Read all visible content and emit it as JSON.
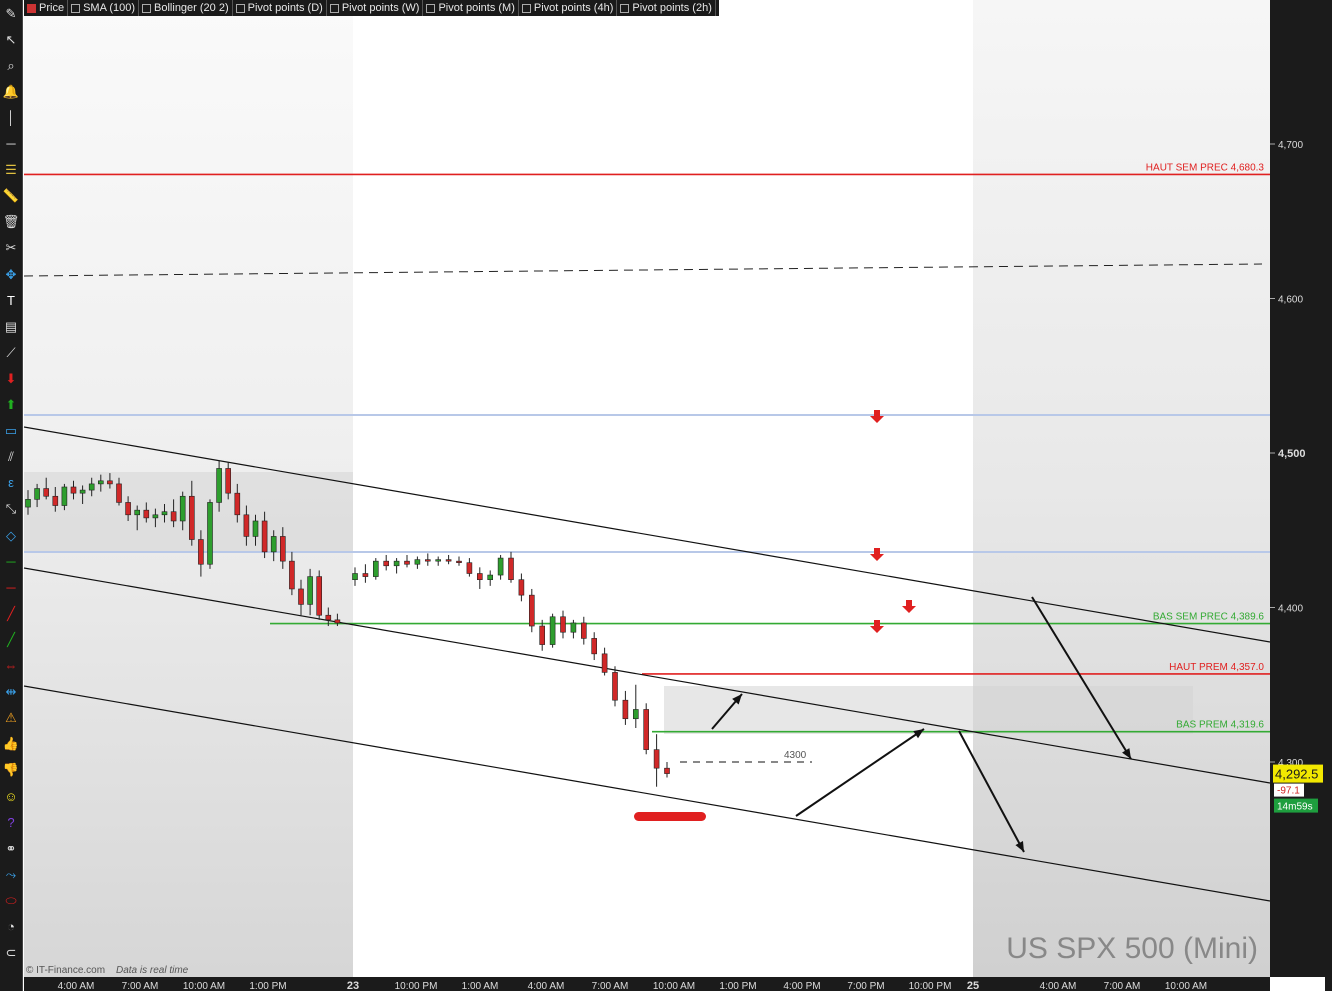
{
  "toolbar": {
    "tools": [
      {
        "name": "pencil-icon",
        "glyph": "✎",
        "color": "#dddddd"
      },
      {
        "name": "cursor-icon",
        "glyph": "↖",
        "color": "#dddddd"
      },
      {
        "name": "zoom-icon",
        "glyph": "⌕",
        "color": "#dddddd"
      },
      {
        "name": "alert-bell-icon",
        "glyph": "🔔",
        "color": "#dddddd"
      },
      {
        "name": "vertical-line-icon",
        "glyph": "│",
        "color": "#dddddd"
      },
      {
        "name": "horizontal-line-icon",
        "glyph": "─",
        "color": "#dddddd"
      },
      {
        "name": "fibonacci-icon",
        "glyph": "☰",
        "color": "#e0c040"
      },
      {
        "name": "ruler-icon",
        "glyph": "📏",
        "color": "#dddddd"
      },
      {
        "name": "trash-icon",
        "glyph": "🗑",
        "color": "#dddddd"
      },
      {
        "name": "wrench-icon",
        "glyph": "✂",
        "color": "#dddddd"
      },
      {
        "name": "crosshair-icon",
        "glyph": "✥",
        "color": "#3aa0e8"
      },
      {
        "name": "text-tool-icon",
        "glyph": "T",
        "color": "#ffffff"
      },
      {
        "name": "document-icon",
        "glyph": "▤",
        "color": "#dddddd"
      },
      {
        "name": "segment-icon",
        "glyph": "⟋",
        "color": "#dddddd"
      },
      {
        "name": "sell-arrow-icon",
        "glyph": "⬇",
        "color": "#e02020"
      },
      {
        "name": "buy-arrow-icon",
        "glyph": "⬆",
        "color": "#20b020"
      },
      {
        "name": "rectangle-icon",
        "glyph": "▭",
        "color": "#3aa0e8"
      },
      {
        "name": "channel-icon",
        "glyph": "⫽",
        "color": "#dddddd"
      },
      {
        "name": "epsilon-icon",
        "glyph": "ε",
        "color": "#3aa0e8"
      },
      {
        "name": "path-icon",
        "glyph": "⤡",
        "color": "#dddddd"
      },
      {
        "name": "diamond-icon",
        "glyph": "◇",
        "color": "#3aa0e8"
      },
      {
        "name": "green-hline-icon",
        "glyph": "─",
        "color": "#20b020"
      },
      {
        "name": "red-hline-icon",
        "glyph": "─",
        "color": "#e02020"
      },
      {
        "name": "red-trendline-icon",
        "glyph": "╱",
        "color": "#e02020"
      },
      {
        "name": "green-trendline-icon",
        "glyph": "╱",
        "color": "#20b020"
      },
      {
        "name": "price-range-icon",
        "glyph": "⇔",
        "color": "#e02020"
      },
      {
        "name": "date-range-icon",
        "glyph": "⇹",
        "color": "#3aa0e8"
      },
      {
        "name": "warning-icon",
        "glyph": "⚠",
        "color": "#f0a020"
      },
      {
        "name": "thumbs-up-icon",
        "glyph": "👍",
        "color": "#20b020"
      },
      {
        "name": "thumbs-down-icon",
        "glyph": "👎",
        "color": "#e02020"
      },
      {
        "name": "smiley-icon",
        "glyph": "☺",
        "color": "#f0e020"
      },
      {
        "name": "help-icon",
        "glyph": "?",
        "color": "#8040e0"
      },
      {
        "name": "link-icon",
        "glyph": "⚭",
        "color": "#dddddd"
      },
      {
        "name": "measure-icon",
        "glyph": "⤳",
        "color": "#3aa0e8"
      },
      {
        "name": "ellipse-icon",
        "glyph": "⬭",
        "color": "#e02020"
      },
      {
        "name": "speed-icon",
        "glyph": "◔",
        "color": "#dddddd"
      },
      {
        "name": "magnet-icon",
        "glyph": "⊂",
        "color": "#dddddd"
      }
    ]
  },
  "legend": [
    {
      "label": "Price",
      "checked": true
    },
    {
      "label": "SMA (100)",
      "checked": false
    },
    {
      "label": "Bollinger (20 2)",
      "checked": false
    },
    {
      "label": "Pivot points (D)",
      "checked": false
    },
    {
      "label": "Pivot points (W)",
      "checked": false
    },
    {
      "label": "Pivot points (M)",
      "checked": false
    },
    {
      "label": "Pivot points (4h)",
      "checked": false
    },
    {
      "label": "Pivot points (2h)",
      "checked": false
    }
  ],
  "chart_data": {
    "type": "candlestick",
    "instrument": "US SPX 500 (Mini)",
    "footer": "© IT-Finance.com",
    "footer_note": "Data is real time",
    "ylim": [
      4200,
      4760
    ],
    "y_ticks": [
      "4,700",
      "4,600",
      "4,500",
      "4,400",
      "4,300"
    ],
    "x_ticks": [
      "4:00 AM",
      "7:00 AM",
      "10:00 AM",
      "1:00 PM",
      "23",
      "10:00 PM",
      "1:00 AM",
      "4:00 AM",
      "7:00 AM",
      "10:00 AM",
      "1:00 PM",
      "4:00 PM",
      "7:00 PM",
      "10:00 PM",
      "25",
      "4:00 AM",
      "7:00 AM",
      "10:00 AM"
    ],
    "last_price": "4,292.5",
    "change": "-97.1",
    "countdown": "14m59s",
    "levels": [
      {
        "label": "HAUT SEM PREC 4,680.3",
        "value": 4680.3,
        "color": "#e02020"
      },
      {
        "label": "BAS SEM PREC 4,389.6",
        "value": 4389.6,
        "color": "#33aa33"
      },
      {
        "label": "HAUT PREM 4,357.0",
        "value": 4357.0,
        "color": "#e02020"
      },
      {
        "label": "BAS PREM 4,319.6",
        "value": 4319.6,
        "color": "#33aa33"
      }
    ],
    "annotation_4300": "4300",
    "candles": [
      [
        4465,
        4476,
        4460,
        4470
      ],
      [
        4470,
        4480,
        4465,
        4477
      ],
      [
        4477,
        4484,
        4470,
        4472
      ],
      [
        4472,
        4478,
        4462,
        4466
      ],
      [
        4466,
        4480,
        4463,
        4478
      ],
      [
        4478,
        4482,
        4470,
        4474
      ],
      [
        4474,
        4479,
        4467,
        4476
      ],
      [
        4476,
        4484,
        4472,
        4480
      ],
      [
        4480,
        4486,
        4475,
        4482
      ],
      [
        4482,
        4487,
        4477,
        4480
      ],
      [
        4480,
        4484,
        4466,
        4468
      ],
      [
        4468,
        4472,
        4456,
        4460
      ],
      [
        4460,
        4466,
        4450,
        4463
      ],
      [
        4463,
        4468,
        4455,
        4458
      ],
      [
        4458,
        4464,
        4452,
        4460
      ],
      [
        4460,
        4467,
        4455,
        4462
      ],
      [
        4462,
        4470,
        4452,
        4456
      ],
      [
        4456,
        4475,
        4450,
        4472
      ],
      [
        4472,
        4482,
        4440,
        4444
      ],
      [
        4444,
        4450,
        4420,
        4428
      ],
      [
        4428,
        4470,
        4425,
        4468
      ],
      [
        4468,
        4495,
        4462,
        4490
      ],
      [
        4490,
        4494,
        4470,
        4474
      ],
      [
        4474,
        4480,
        4455,
        4460
      ],
      [
        4460,
        4466,
        4440,
        4446
      ],
      [
        4446,
        4460,
        4440,
        4456
      ],
      [
        4456,
        4462,
        4432,
        4436
      ],
      [
        4436,
        4450,
        4430,
        4446
      ],
      [
        4446,
        4452,
        4425,
        4430
      ],
      [
        4430,
        4436,
        4408,
        4412
      ],
      [
        4412,
        4418,
        4395,
        4402
      ],
      [
        4402,
        4425,
        4395,
        4420
      ],
      [
        4420,
        4424,
        4392,
        4395
      ],
      [
        4395,
        4400,
        4388,
        4392
      ],
      [
        4392,
        4396,
        4388,
        4390
      ],
      [
        4418,
        4426,
        4414,
        4422
      ],
      [
        4422,
        4428,
        4416,
        4420
      ],
      [
        4420,
        4432,
        4418,
        4430
      ],
      [
        4430,
        4434,
        4424,
        4427
      ],
      [
        4427,
        4432,
        4422,
        4430
      ],
      [
        4430,
        4434,
        4426,
        4428
      ],
      [
        4428,
        4433,
        4425,
        4431
      ],
      [
        4431,
        4435,
        4427,
        4430
      ],
      [
        4430,
        4433,
        4427,
        4431
      ],
      [
        4431,
        4434,
        4428,
        4430
      ],
      [
        4430,
        4433,
        4427,
        4429
      ],
      [
        4429,
        4432,
        4420,
        4422
      ],
      [
        4422,
        4426,
        4412,
        4418
      ],
      [
        4418,
        4424,
        4414,
        4421
      ],
      [
        4421,
        4434,
        4418,
        4432
      ],
      [
        4432,
        4436,
        4416,
        4418
      ],
      [
        4418,
        4422,
        4404,
        4408
      ],
      [
        4408,
        4412,
        4384,
        4388
      ],
      [
        4388,
        4392,
        4372,
        4376
      ],
      [
        4376,
        4396,
        4374,
        4394
      ],
      [
        4394,
        4398,
        4380,
        4384
      ],
      [
        4384,
        4392,
        4380,
        4390
      ],
      [
        4390,
        4394,
        4376,
        4380
      ],
      [
        4380,
        4384,
        4366,
        4370
      ],
      [
        4370,
        4374,
        4356,
        4358
      ],
      [
        4358,
        4362,
        4336,
        4340
      ],
      [
        4340,
        4346,
        4324,
        4328
      ],
      [
        4328,
        4350,
        4322,
        4334
      ],
      [
        4334,
        4338,
        4305,
        4308
      ],
      [
        4308,
        4318,
        4284,
        4296
      ],
      [
        4296,
        4300,
        4290,
        4292.5
      ]
    ]
  }
}
